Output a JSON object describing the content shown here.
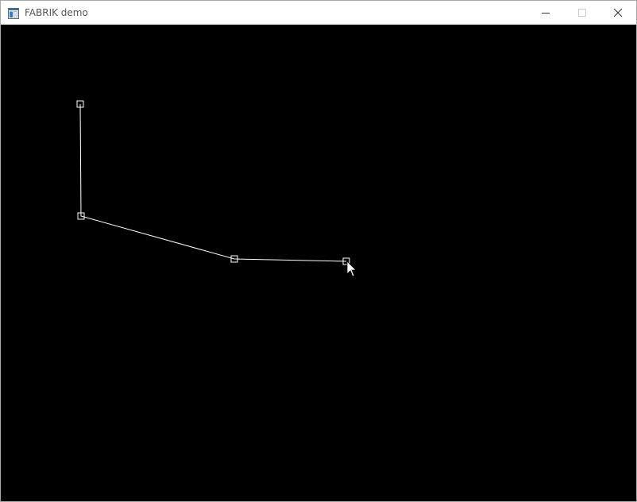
{
  "window": {
    "title": "FABRIK demo"
  },
  "titlebar_buttons": {
    "minimize_icon": "minimize-icon",
    "maximize_icon": "maximize-icon",
    "close_icon": "close-icon"
  },
  "canvas": {
    "background": "#000000",
    "line_color": "#ffffff"
  }
}
